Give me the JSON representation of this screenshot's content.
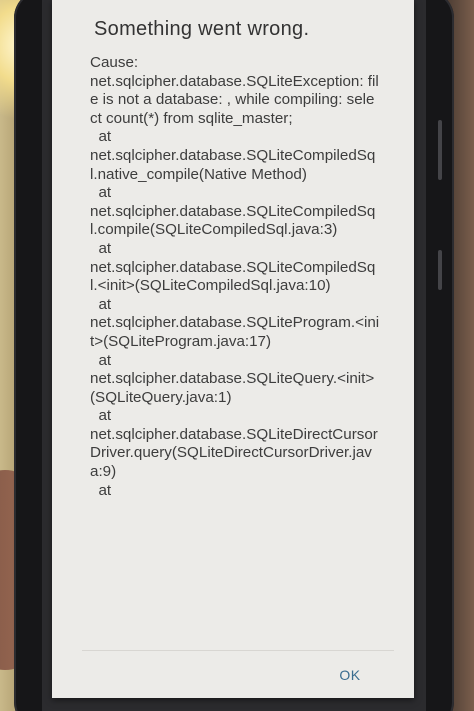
{
  "dialog": {
    "title": "Something went wrong.",
    "message": "Cause:\nnet.sqlcipher.database.SQLiteException: file is not a database: , while compiling: select count(*) from sqlite_master;\n  at\nnet.sqlcipher.database.SQLiteCompiledSql.native_compile(Native Method)\n  at\nnet.sqlcipher.database.SQLiteCompiledSql.compile(SQLiteCompiledSql.java:3)\n  at\nnet.sqlcipher.database.SQLiteCompiledSql.<init>(SQLiteCompiledSql.java:10)\n  at\nnet.sqlcipher.database.SQLiteProgram.<init>(SQLiteProgram.java:17)\n  at\nnet.sqlcipher.database.SQLiteQuery.<init>(SQLiteQuery.java:1)\n  at\nnet.sqlcipher.database.SQLiteDirectCursorDriver.query(SQLiteDirectCursorDriver.java:9)\n  at",
    "ok_label": "OK"
  },
  "colors": {
    "dialog_background": "#ecebe8",
    "text": "#3d3d3d",
    "button_accent": "#3a6c8f"
  }
}
